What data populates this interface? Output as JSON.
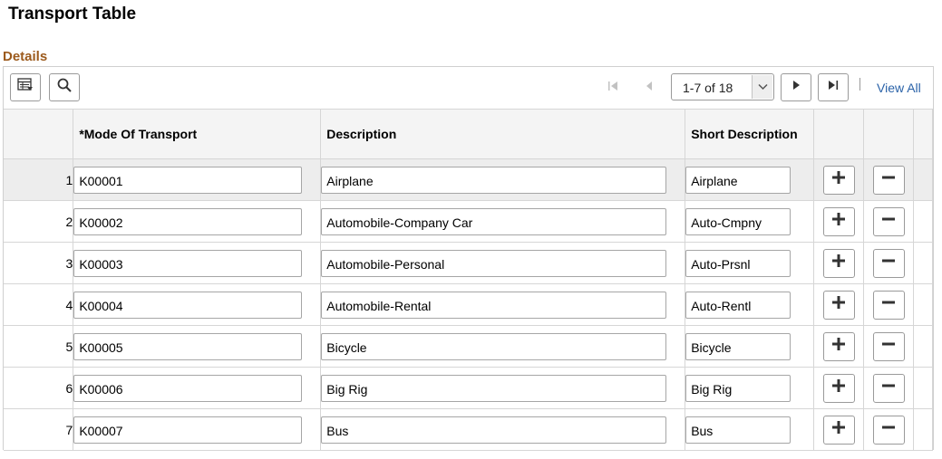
{
  "page": {
    "title": "Transport Table"
  },
  "section": {
    "title": "Details"
  },
  "toolbar": {
    "icons": [
      "personalize-grid-icon",
      "find-icon"
    ]
  },
  "pagination": {
    "range": "1-7 of 18",
    "view_all": "View All",
    "icons": [
      "first-icon",
      "previous-icon",
      "dropdown-icon",
      "next-icon",
      "last-icon"
    ]
  },
  "columns": {
    "mode": "*Mode Of Transport",
    "description": "Description",
    "short_description": "Short Description"
  },
  "rows": [
    {
      "num": "1",
      "mode": "K00001",
      "description": "Airplane",
      "short": "Airplane"
    },
    {
      "num": "2",
      "mode": "K00002",
      "description": "Automobile-Company Car",
      "short": "Auto-Cmpny"
    },
    {
      "num": "3",
      "mode": "K00003",
      "description": "Automobile-Personal",
      "short": "Auto-Prsnl"
    },
    {
      "num": "4",
      "mode": "K00004",
      "description": "Automobile-Rental",
      "short": "Auto-Rentl"
    },
    {
      "num": "5",
      "mode": "K00005",
      "description": "Bicycle",
      "short": "Bicycle"
    },
    {
      "num": "6",
      "mode": "K00006",
      "description": "Big Rig",
      "short": "Big Rig"
    },
    {
      "num": "7",
      "mode": "K00007",
      "description": "Bus",
      "short": "Bus"
    }
  ],
  "row_actions": {
    "icons": [
      "add-row-icon",
      "delete-row-icon"
    ]
  },
  "colors": {
    "section_title": "#9c5a1c",
    "link": "#2a62a8",
    "selected_row": "#ededed",
    "header_bg": "#f4f4f4"
  }
}
